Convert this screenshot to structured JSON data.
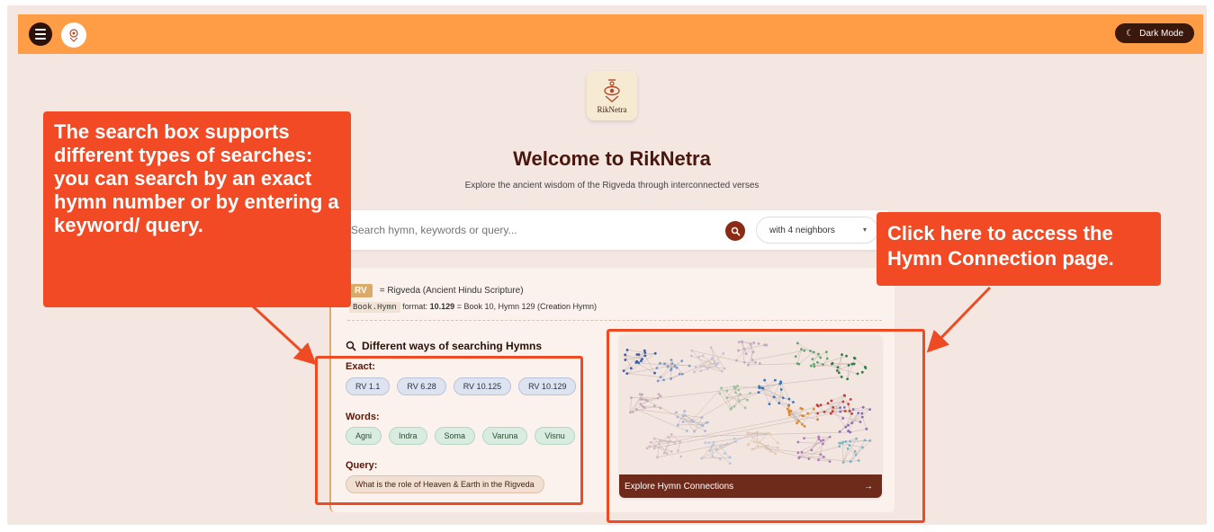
{
  "header": {
    "brand_small": "RikNetra",
    "dark_mode_label": "Dark Mode"
  },
  "hero": {
    "logo_text": "RikNetra",
    "title": "Welcome to RikNetra",
    "subtitle": "Explore the ancient wisdom of the Rigveda through interconnected verses"
  },
  "search": {
    "placeholder": "Search hymn, keywords or query...",
    "neighbors_value": "with 4 neighbors"
  },
  "legend": {
    "rv_chip": "RV",
    "rv_desc": "= Rigveda (Ancient Hindu Scripture)",
    "format_chip": "Book.Hymn",
    "format_prefix": "format:",
    "format_example": "10.129",
    "format_desc": "= Book 10, Hymn 129 (Creation Hymn)"
  },
  "ways": {
    "title": "Different ways of searching Hymns",
    "exact_label": "Exact:",
    "exact_chips": [
      "RV 1.1",
      "RV 6.28",
      "RV 10.125",
      "RV 10.129"
    ],
    "words_label": "Words:",
    "word_chips": [
      "Agni",
      "Indra",
      "Soma",
      "Varuna",
      "Visnu"
    ],
    "query_label": "Query:",
    "query_chip": "What is the role of Heaven & Earth in the Rigveda"
  },
  "graph_card": {
    "label": "Explore Hymn Connections",
    "arrow": "→"
  },
  "annotations": {
    "left": "The search box supports different types of searches: you can search by an exact hymn number or by entering a keyword/ query.",
    "right": "Click here to access the Hymn Connection page."
  },
  "colors": {
    "topbar": "#ff9d47",
    "callout": "#f24a25",
    "accent": "#8a2b15"
  }
}
